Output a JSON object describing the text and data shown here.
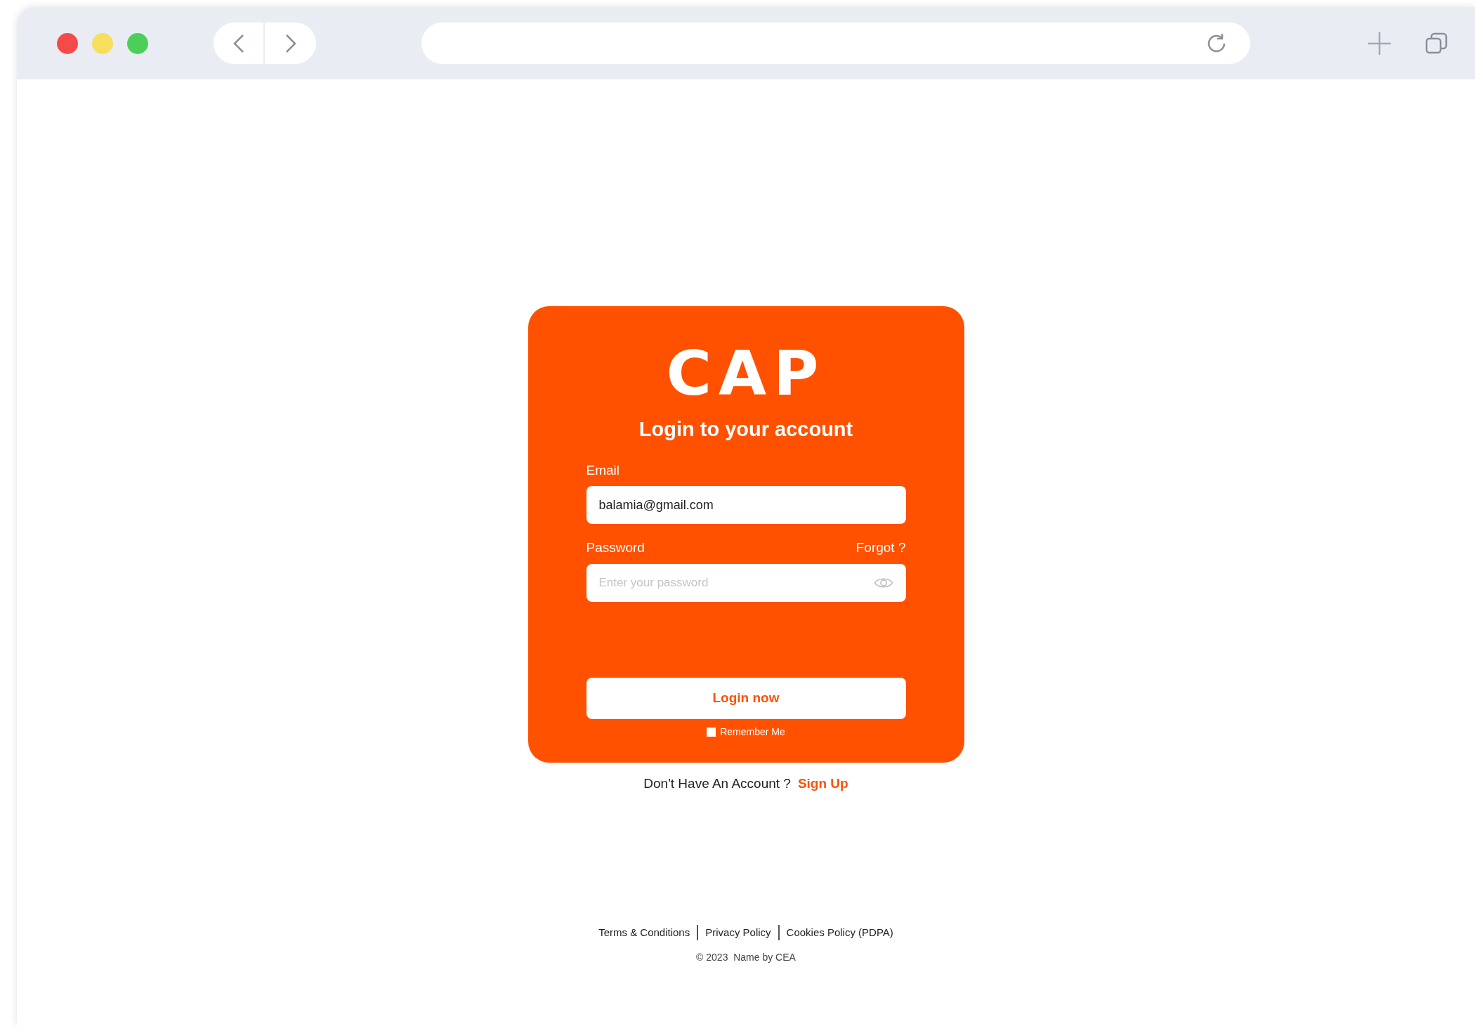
{
  "login": {
    "logo": "CAP",
    "title": "Login to your account",
    "email": {
      "label": "Email",
      "value": "balamia@gmail.com"
    },
    "password": {
      "label": "Password",
      "forgot": "Forgot ?",
      "placeholder": "Enter your password"
    },
    "submit": "Login now",
    "remember": {
      "label": "Remember Me",
      "checked": false
    }
  },
  "signup": {
    "prompt": "Don't Have An Account ?",
    "link": "Sign Up"
  },
  "footer": {
    "links": [
      "Terms & Conditions",
      "Privacy Policy",
      "Cookies Policy (PDPA)"
    ],
    "copyright": "© 2023  Name by CEA"
  }
}
